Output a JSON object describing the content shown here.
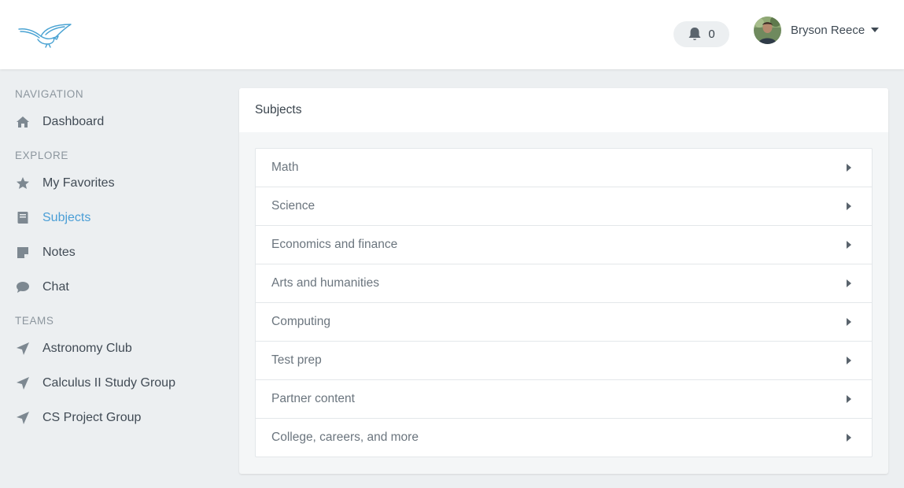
{
  "header": {
    "logo_icon": "bird-logo-icon",
    "notifications": {
      "icon": "bell-icon",
      "count": "0"
    },
    "user": {
      "name": "Bryson Reece",
      "avatar_icon": "avatar-photo"
    }
  },
  "sidebar": {
    "sections": [
      {
        "label": "NAVIGATION",
        "items": [
          {
            "label": "Dashboard",
            "icon": "home-icon"
          }
        ]
      },
      {
        "label": "EXPLORE",
        "items": [
          {
            "label": "My Favorites",
            "icon": "star-icon"
          },
          {
            "label": "Subjects",
            "icon": "book-icon",
            "active": true
          },
          {
            "label": "Notes",
            "icon": "note-icon"
          },
          {
            "label": "Chat",
            "icon": "chat-bubble-icon"
          }
        ]
      },
      {
        "label": "TEAMS",
        "items": [
          {
            "label": "Astronomy Club",
            "icon": "paper-plane-icon"
          },
          {
            "label": "Calculus II Study Group",
            "icon": "paper-plane-icon"
          },
          {
            "label": "CS Project Group",
            "icon": "paper-plane-icon"
          }
        ]
      }
    ],
    "active_color": "#4a9ed6"
  },
  "main": {
    "title": "Subjects",
    "subjects": [
      "Math",
      "Science",
      "Economics and finance",
      "Arts and humanities",
      "Computing",
      "Test prep",
      "Partner content",
      "College, careers, and more"
    ]
  }
}
